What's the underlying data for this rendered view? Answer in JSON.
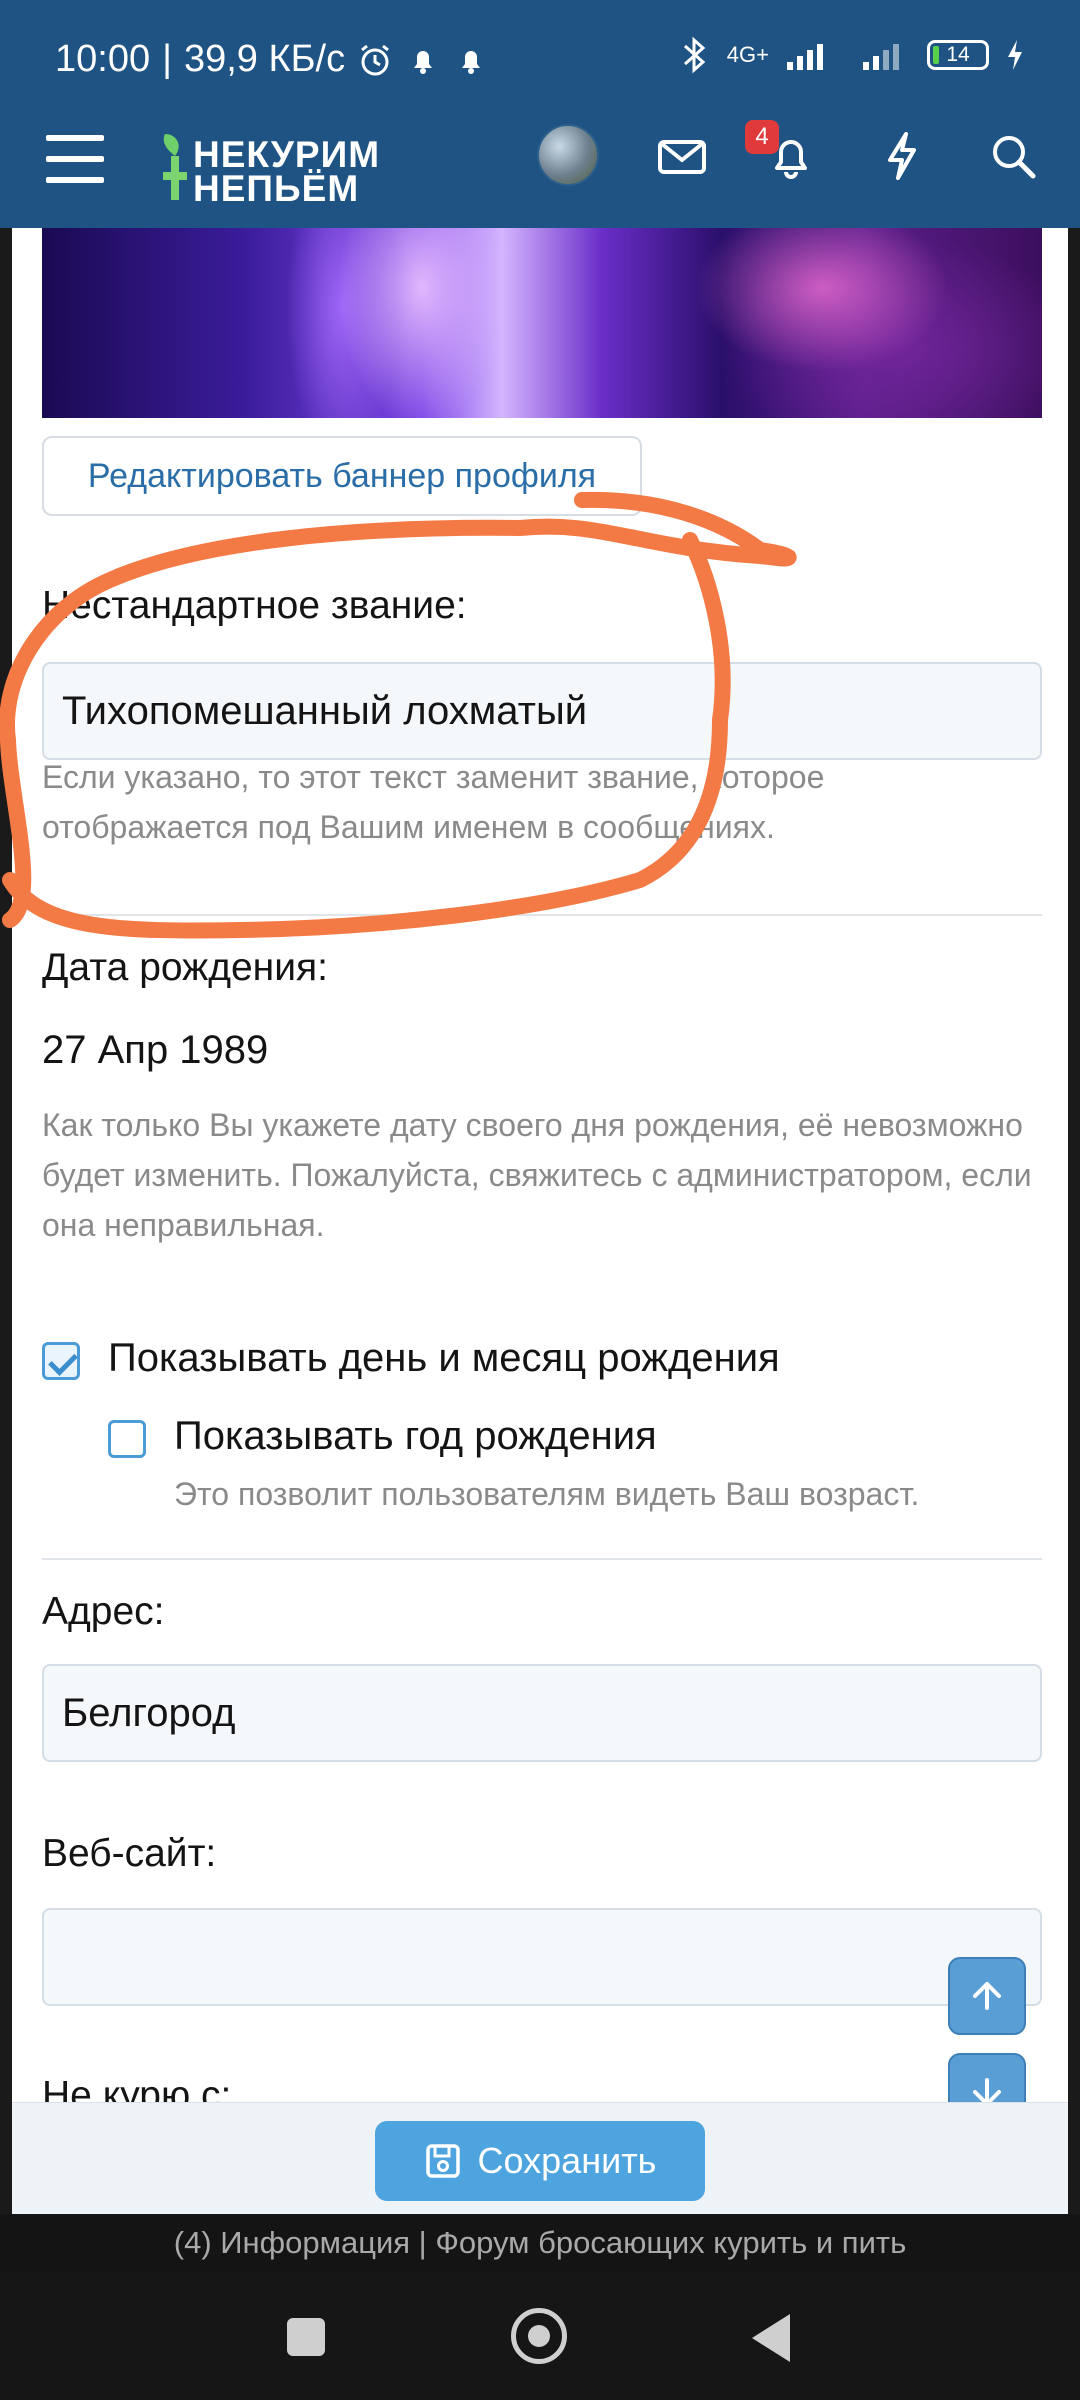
{
  "status_bar": {
    "time": "10:00",
    "speed": "39,9 КБ/с",
    "network_label": "4G+",
    "battery": "14"
  },
  "app_header": {
    "logo_line1": "НЕКУРИМ",
    "logo_line2": "НЕПЬЁМ",
    "notification_count": "4"
  },
  "profile_form": {
    "edit_banner_button": "Редактировать баннер профиля",
    "custom_title_label": "Нестандартное звание:",
    "custom_title_value": "Тихопомешанный лохматый",
    "custom_title_hint": "Если указано, то этот текст заменит звание, которое отображается под Вашим именем в сообщениях.",
    "dob_label": "Дата рождения:",
    "dob_value": "27 Апр 1989",
    "dob_hint": "Как только Вы укажете дату своего дня рождения, её невозможно будет изменить. Пожалуйста, свяжитесь с администратором, если она неправильная.",
    "show_day_month_label": "Показывать день и месяц рождения",
    "show_day_month_checked": true,
    "show_year_label": "Показывать год рождения",
    "show_year_checked": false,
    "show_year_hint": "Это позволит пользователям видеть Ваш возраст.",
    "address_label": "Адрес:",
    "address_value": "Белгород",
    "website_label": "Веб-сайт:",
    "website_value": "",
    "quit_since_label": "Не курю с:",
    "save_button": "Сохранить"
  },
  "page_title": "(4) Информация | Форум бросающих курить и пить",
  "colors": {
    "header_bg": "#1e5383",
    "accent": "#4da4df",
    "annotation_stroke": "#f47a45",
    "badge": "#e03a3a"
  }
}
